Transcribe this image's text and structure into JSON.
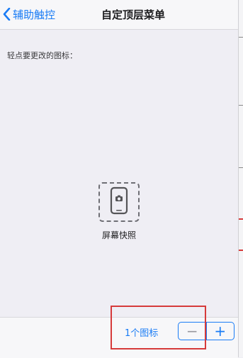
{
  "nav": {
    "back_label": "辅助触控",
    "title": "自定顶层菜单"
  },
  "content": {
    "hint": "轻点要更改的图标：",
    "icon": {
      "name": "camera-icon",
      "label": "屏幕快照"
    }
  },
  "toolbar": {
    "count_label": "1个图标",
    "minus_label": "−",
    "plus_label": "+"
  },
  "colors": {
    "accent": "#1a7cf5",
    "annotation": "#d63a3a",
    "background": "#efeef4"
  }
}
